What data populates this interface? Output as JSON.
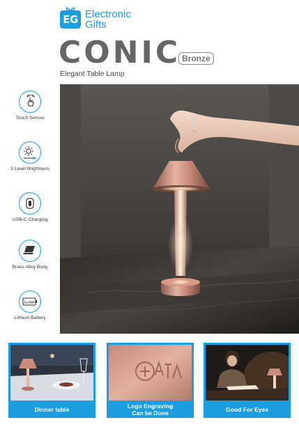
{
  "brand": {
    "badge": "EG",
    "line1": "Electronic",
    "line2": "Gifts",
    "color": "#1a9ee0"
  },
  "product": {
    "name": "CONIC",
    "variant": "Bronze",
    "subtitle": "Elegant Table Lamp"
  },
  "features": [
    {
      "icon": "touch-hand-icon",
      "label": "Touch Sensor"
    },
    {
      "icon": "brightness-icon",
      "label": "3 Level Brightness"
    },
    {
      "icon": "usb-c-icon",
      "label": "USB-C Charging"
    },
    {
      "icon": "laptop-icon",
      "label": "Brass Alloy Body"
    },
    {
      "icon": "battery-icon",
      "label": "Lithium Battery",
      "badge": "Li-ion"
    }
  ],
  "tiles": [
    {
      "label": "Dinner table"
    },
    {
      "label_line1": "Logo Engraving",
      "label_line2": "Can be Done"
    },
    {
      "label": "Good For Eyes"
    }
  ]
}
